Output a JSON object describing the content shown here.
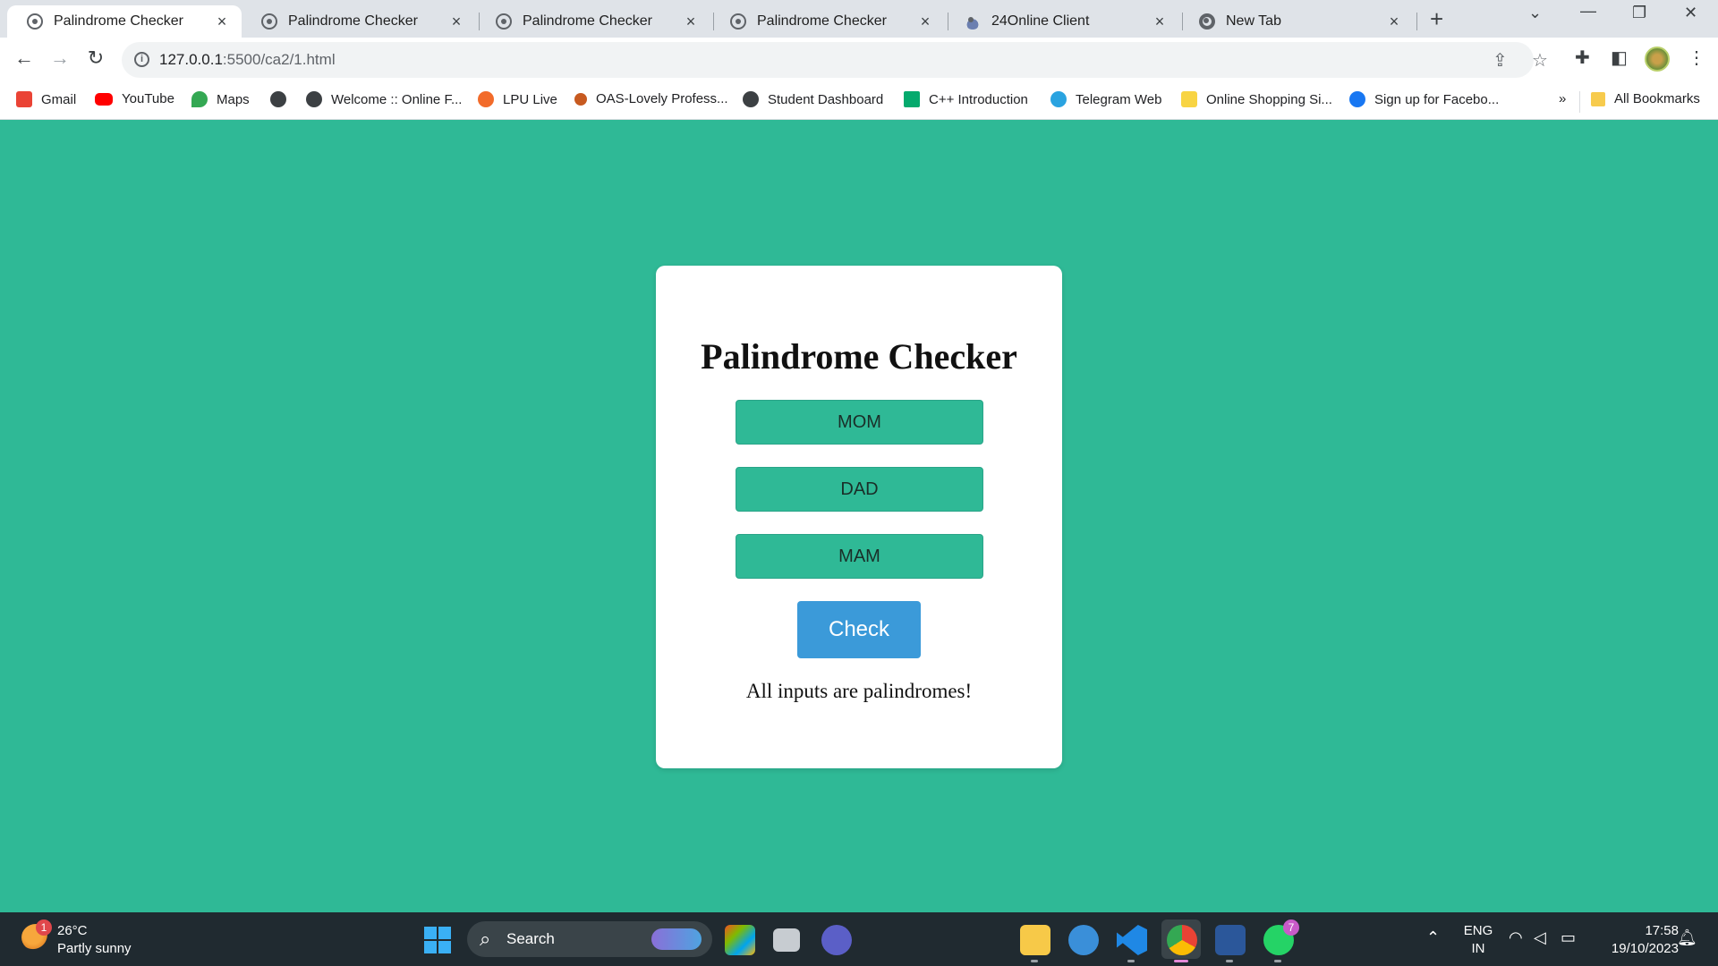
{
  "browser": {
    "tabs": [
      {
        "title": "Palindrome Checker",
        "active": true,
        "icon": "broadcast-icon"
      },
      {
        "title": "Palindrome Checker",
        "active": false,
        "icon": "broadcast-icon"
      },
      {
        "title": "Palindrome Checker",
        "active": false,
        "icon": "broadcast-icon"
      },
      {
        "title": "Palindrome Checker",
        "active": false,
        "icon": "broadcast-icon"
      },
      {
        "title": "24Online Client",
        "active": false,
        "icon": "cloud-icon"
      },
      {
        "title": "New Tab",
        "active": false,
        "icon": "chrome-icon"
      }
    ],
    "tab_close": "×",
    "new_tab": "+",
    "url_host": "127.0.0.1",
    "url_path": ":5500/ca2/1.html",
    "bookmarks": [
      {
        "label": "Gmail",
        "icon": "gmail-icon",
        "color": "#ea4335"
      },
      {
        "label": "YouTube",
        "icon": "youtube-icon",
        "color": "#ff0000"
      },
      {
        "label": "Maps",
        "icon": "maps-icon",
        "color": "#34a853"
      },
      {
        "label": "",
        "icon": "globe-icon",
        "color": "#3c4043"
      },
      {
        "label": "Welcome :: Online F...",
        "icon": "globe-icon",
        "color": "#3c4043"
      },
      {
        "label": "LPU Live",
        "icon": "lpu-live-icon",
        "color": "#f26b2a"
      },
      {
        "label": "OAS-Lovely Profess...",
        "icon": "lpu-icon",
        "color": "#c75a20"
      },
      {
        "label": "Student Dashboard",
        "icon": "globe-icon",
        "color": "#3c4043"
      },
      {
        "label": "C++ Introduction",
        "icon": "w3schools-icon",
        "color": "#04aa6d"
      },
      {
        "label": "Telegram Web",
        "icon": "telegram-icon",
        "color": "#2aa3e0"
      },
      {
        "label": "Online Shopping Si...",
        "icon": "flipkart-icon",
        "color": "#f8d443"
      },
      {
        "label": "Sign up for Facebo...",
        "icon": "facebook-icon",
        "color": "#1877f2"
      }
    ],
    "bookmarks_overflow": "»",
    "all_bookmarks": "All Bookmarks"
  },
  "page": {
    "title": "Palindrome Checker",
    "inputs": [
      "MOM",
      "DAD",
      "MAM"
    ],
    "check_label": "Check",
    "result": "All inputs are palindromes!",
    "background_color": "#2fb996",
    "button_color": "#3b9ad9"
  },
  "taskbar": {
    "weather_badge": "1",
    "temperature": "26°C",
    "weather_desc": "Partly sunny",
    "search_label": "Search",
    "whatsapp_badge": "7",
    "lang_top": "ENG",
    "lang_bottom": "IN",
    "time": "17:58",
    "date": "19/10/2023"
  }
}
